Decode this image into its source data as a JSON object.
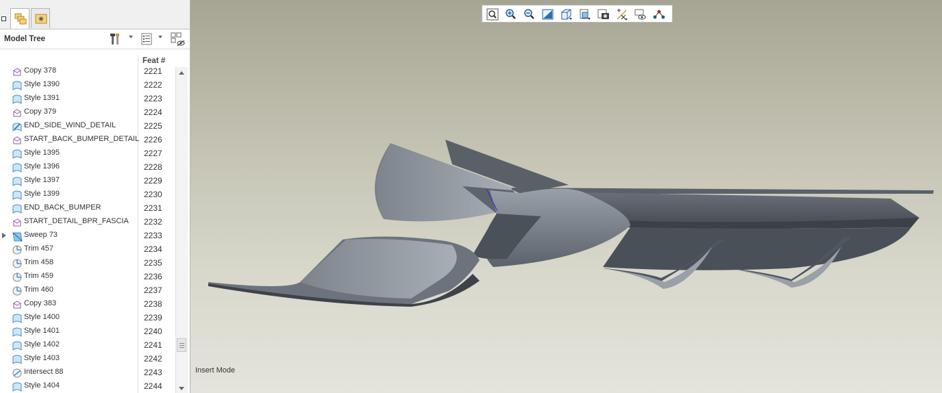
{
  "model_tree": {
    "title": "Model Tree",
    "column_header": "Feat #",
    "rows": [
      {
        "name": "Copy 378",
        "feat": "2221",
        "icon": "copy-icon"
      },
      {
        "name": "Style 1390",
        "feat": "2222",
        "icon": "style-icon"
      },
      {
        "name": "Style 1391",
        "feat": "2223",
        "icon": "style-icon"
      },
      {
        "name": "Copy 379",
        "feat": "2224",
        "icon": "copy-icon"
      },
      {
        "name": "END_SIDE_WIND_DETAIL",
        "feat": "2225",
        "icon": "insert-here-icon"
      },
      {
        "name": "START_BACK_BUMPER_DETAIL",
        "feat": "2226",
        "icon": "copy-icon"
      },
      {
        "name": "Style 1395",
        "feat": "2227",
        "icon": "style-icon"
      },
      {
        "name": "Style 1396",
        "feat": "2228",
        "icon": "style-icon"
      },
      {
        "name": "Style 1397",
        "feat": "2229",
        "icon": "style-icon"
      },
      {
        "name": "Style 1399",
        "feat": "2230",
        "icon": "style-icon"
      },
      {
        "name": "END_BACK_BUMPER",
        "feat": "2231",
        "icon": "style-icon"
      },
      {
        "name": "START_DETAIL_BPR_FASCIA",
        "feat": "2232",
        "icon": "copy-icon"
      },
      {
        "name": "Sweep 73",
        "feat": "2233",
        "icon": "sweep-icon",
        "expandable": true
      },
      {
        "name": "Trim 457",
        "feat": "2234",
        "icon": "trim-icon"
      },
      {
        "name": "Trim 458",
        "feat": "2235",
        "icon": "trim-icon"
      },
      {
        "name": "Trim 459",
        "feat": "2236",
        "icon": "trim-icon"
      },
      {
        "name": "Trim 460",
        "feat": "2237",
        "icon": "trim-icon"
      },
      {
        "name": "Copy 383",
        "feat": "2238",
        "icon": "copy-icon"
      },
      {
        "name": "Style 1400",
        "feat": "2239",
        "icon": "style-icon"
      },
      {
        "name": "Style 1401",
        "feat": "2240",
        "icon": "style-icon"
      },
      {
        "name": "Style 1402",
        "feat": "2241",
        "icon": "style-icon"
      },
      {
        "name": "Style 1403",
        "feat": "2242",
        "icon": "style-icon"
      },
      {
        "name": "Intersect 88",
        "feat": "2243",
        "icon": "intersect-icon"
      },
      {
        "name": "Style 1404",
        "feat": "2244",
        "icon": "style-icon"
      }
    ]
  },
  "viewport": {
    "status_text": "Insert Mode",
    "toolbar_icons": [
      "refit-icon",
      "zoom-in-icon",
      "zoom-out-icon",
      "repaint-icon",
      "display-style-icon",
      "saved-orientations-icon",
      "view-manager-icon",
      "datum-display-icon",
      "spin-center-icon",
      "annotation-display-icon"
    ]
  },
  "colors": {
    "icon_blue": "#3f8fd0",
    "icon_purple": "#8a5aa8",
    "model_dark": "#4a4f58",
    "model_light": "#8e949c"
  }
}
